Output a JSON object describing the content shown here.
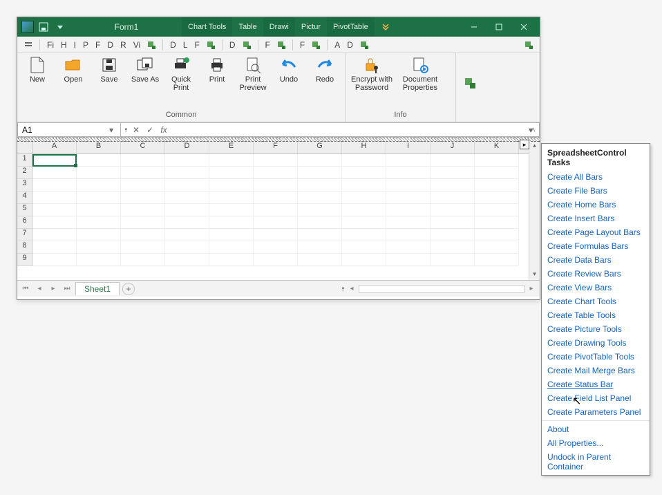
{
  "titlebar": {
    "form_title": "Form1",
    "tabs": [
      "Chart Tools",
      "Table",
      "Drawi",
      "Pictur",
      "PivotTable"
    ]
  },
  "minibar": {
    "items": [
      "Fi",
      "H",
      "I",
      "P",
      "F",
      "D",
      "R",
      "Vi"
    ],
    "items2": [
      "D",
      "L",
      "F"
    ],
    "items3": [
      "D"
    ],
    "items4": [
      "F",
      "F"
    ],
    "items5": [
      "A",
      "D"
    ]
  },
  "ribbon": {
    "common": {
      "label": "Common",
      "buttons": {
        "new": "New",
        "open": "Open",
        "save": "Save",
        "saveas": "Save As",
        "quickprint": "Quick Print",
        "print": "Print",
        "preview": "Print Preview",
        "undo": "Undo",
        "redo": "Redo"
      }
    },
    "info": {
      "label": "Info",
      "buttons": {
        "encrypt": "Encrypt with Password",
        "docprops": "Document Properties"
      }
    }
  },
  "namebox": {
    "value": "A1"
  },
  "grid": {
    "cols": [
      "A",
      "B",
      "C",
      "D",
      "E",
      "F",
      "G",
      "H",
      "I",
      "J",
      "K"
    ],
    "rows": [
      "1",
      "2",
      "3",
      "4",
      "5",
      "6",
      "7",
      "8",
      "9"
    ]
  },
  "sheetbar": {
    "active": "Sheet1"
  },
  "smart_panel": {
    "title": "SpreadsheetControl Tasks",
    "links": [
      "Create All Bars",
      "Create File Bars",
      "Create Home Bars",
      "Create Insert Bars",
      "Create Page Layout Bars",
      "Create Formulas Bars",
      "Create Data Bars",
      "Create Review Bars",
      "Create View Bars",
      "Create Chart Tools",
      "Create Table Tools",
      "Create Picture Tools",
      "Create Drawing Tools",
      "Create PivotTable Tools",
      "Create Mail Merge Bars",
      "Create Status Bar",
      "Create Field List Panel",
      "Create Parameters Panel"
    ],
    "footer_links": [
      "About",
      "All Properties...",
      "Undock in Parent Container"
    ]
  }
}
